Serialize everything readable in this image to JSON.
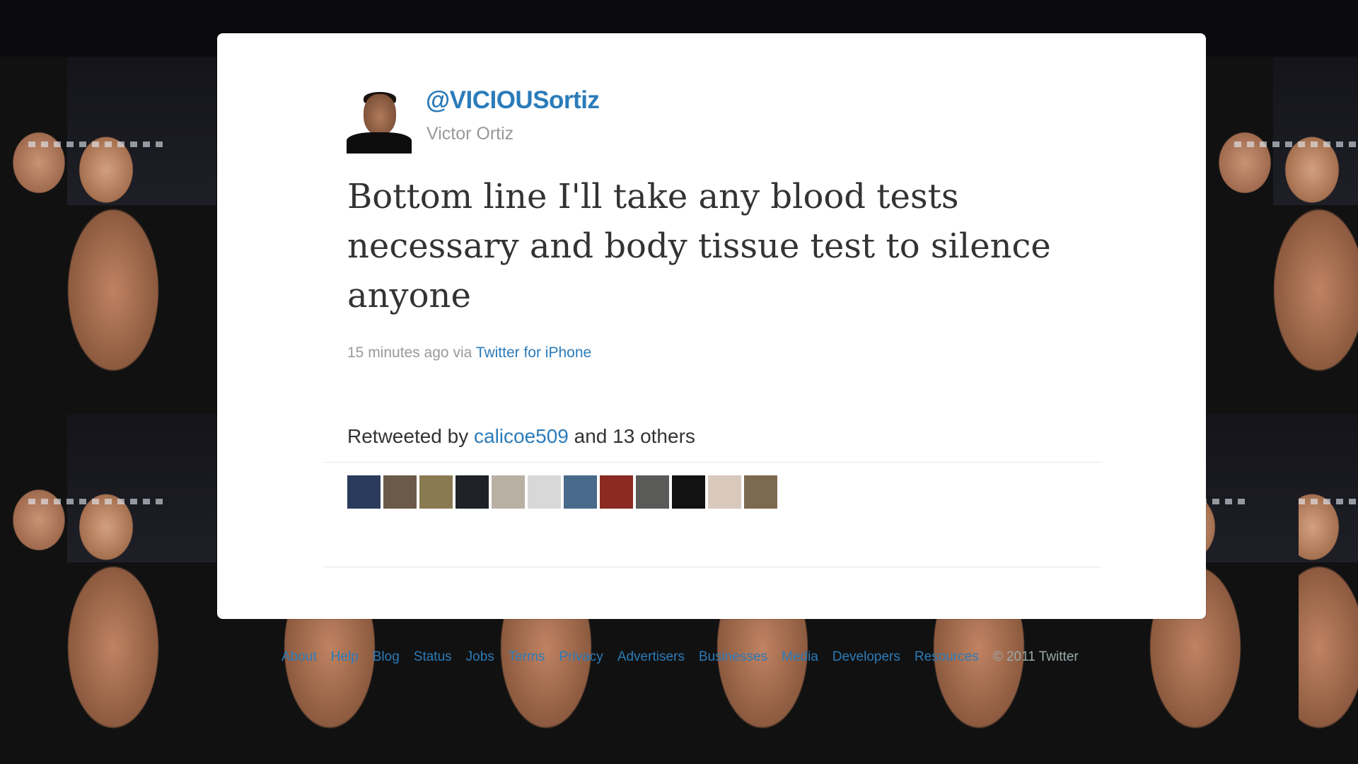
{
  "tweet": {
    "handle": "@VICIOUSortiz",
    "name": "Victor Ortiz",
    "text": "Bottom line I'll take any blood tests necessary and body tissue test to silence anyone",
    "time": "15 minutes ago",
    "via_label": "via",
    "source": "Twitter for iPhone"
  },
  "retweets": {
    "prefix": "Retweeted by",
    "user": "calicoe509",
    "suffix": "and 13 others",
    "avatars": [
      {
        "name": "rt-avatar-1",
        "color": "#2a3b5c"
      },
      {
        "name": "rt-avatar-2",
        "color": "#6b5a48"
      },
      {
        "name": "rt-avatar-3",
        "color": "#8a7a52"
      },
      {
        "name": "rt-avatar-4",
        "color": "#1e2226"
      },
      {
        "name": "rt-avatar-5",
        "color": "#b9b0a4"
      },
      {
        "name": "rt-avatar-6",
        "color": "#d8d8d8"
      },
      {
        "name": "rt-avatar-7",
        "color": "#4a6a8c"
      },
      {
        "name": "rt-avatar-8",
        "color": "#8c2a22"
      },
      {
        "name": "rt-avatar-9",
        "color": "#5a5a58"
      },
      {
        "name": "rt-avatar-10",
        "color": "#121212"
      },
      {
        "name": "rt-avatar-11",
        "color": "#d9c8bc"
      },
      {
        "name": "rt-avatar-12",
        "color": "#7c6a50"
      }
    ]
  },
  "footer": {
    "links": [
      "About",
      "Help",
      "Blog",
      "Status",
      "Jobs",
      "Terms",
      "Privacy",
      "Advertisers",
      "Businesses",
      "Media",
      "Developers",
      "Resources"
    ],
    "copyright": "© 2011 Twitter"
  },
  "colors": {
    "link": "#2b7bb9",
    "text": "#333333",
    "muted": "#999999"
  }
}
